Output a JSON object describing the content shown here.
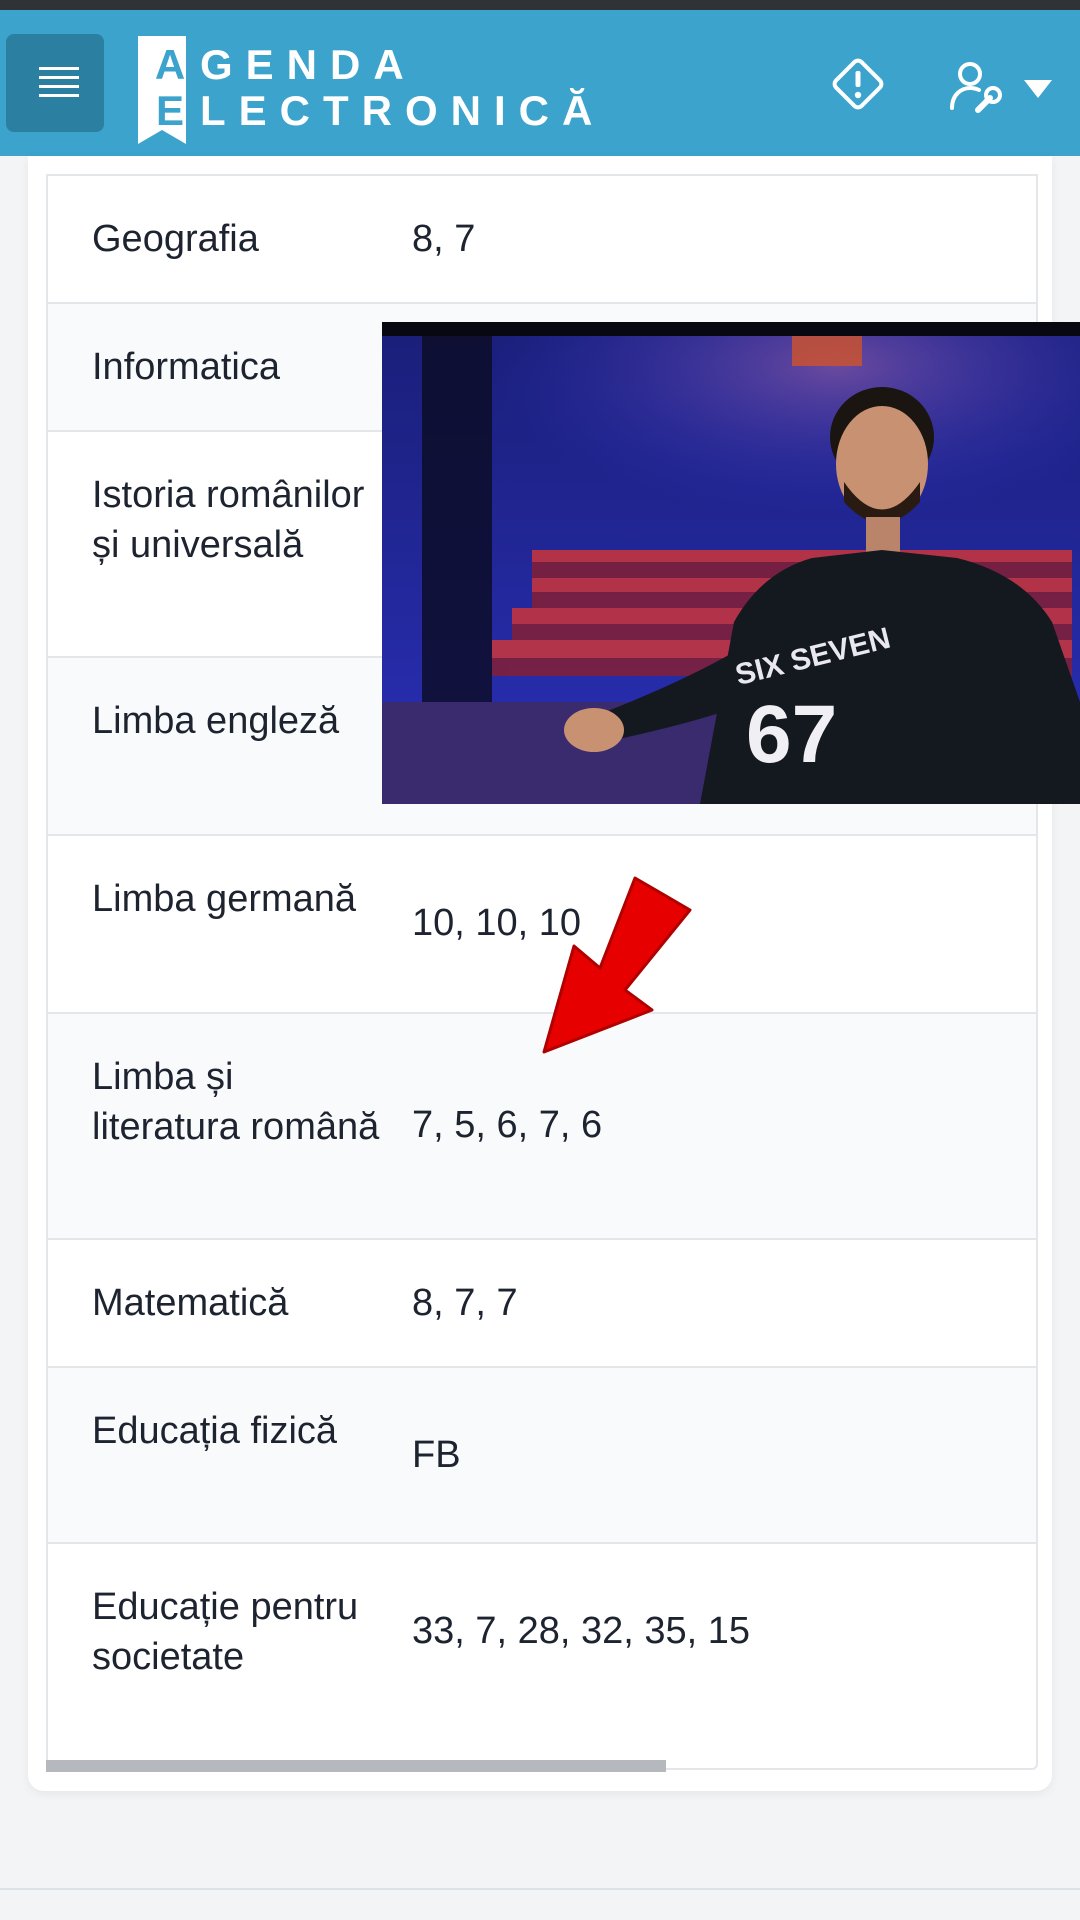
{
  "header": {
    "logo_line1_first": "A",
    "logo_line1_rest": "GENDA",
    "logo_line2_first": "E",
    "logo_line2_rest": "LECTRONICĂ",
    "menu_icon": "hamburger-icon",
    "alert_icon": "warning-diamond-icon",
    "user_icon": "user-settings-icon",
    "dropdown_icon": "caret-down-icon"
  },
  "grades_table": {
    "rows": [
      {
        "subject": "Geografia",
        "grades": "8, 7"
      },
      {
        "subject": "Informatica",
        "grades": ""
      },
      {
        "subject": "Istoria românilor și universală",
        "grades": ""
      },
      {
        "subject": "Limba engleză",
        "grades": ""
      },
      {
        "subject": "Limba germană",
        "grades": "10, 10, 10"
      },
      {
        "subject": "Limba și literatura română",
        "grades": "7, 5, 6, 7, 6"
      },
      {
        "subject": "Matematică",
        "grades": "8, 7, 7"
      },
      {
        "subject": "Educația fizică",
        "grades": "FB"
      },
      {
        "subject": "Educație pentru societate",
        "grades": "33, 7, 28, 32, 35, 15"
      }
    ]
  },
  "overlay": {
    "shirt_text": "SIX SEVEN",
    "shirt_number": "67"
  },
  "colors": {
    "header_bg": "#3ba3cc",
    "menu_button_bg": "#2b7fa0",
    "arrow": "#e60000"
  }
}
